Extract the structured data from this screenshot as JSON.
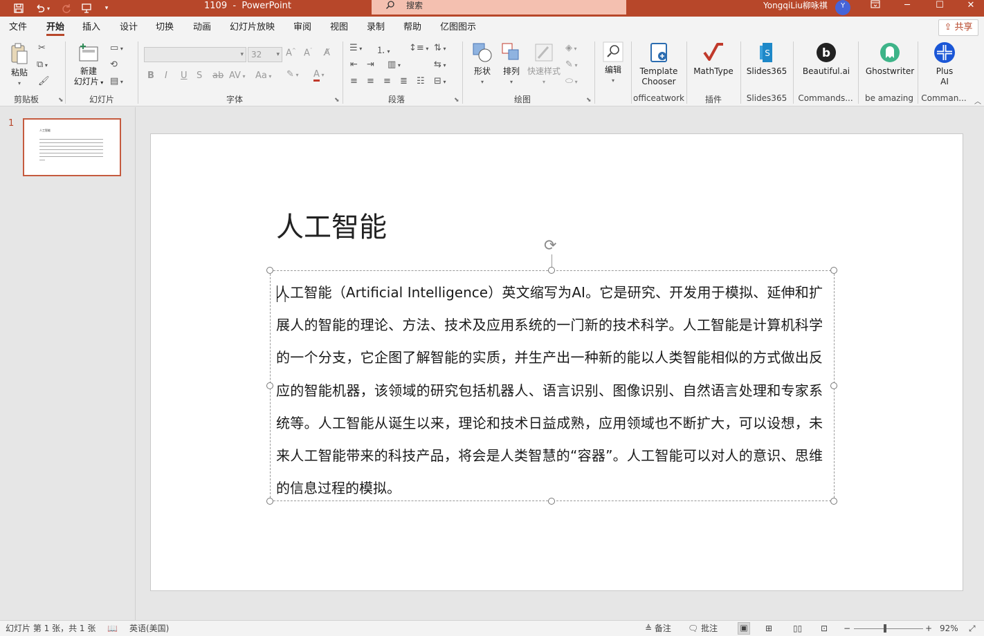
{
  "app": {
    "doc_title": "1109",
    "app_name": "PowerPoint",
    "search_placeholder": "搜索",
    "user_name": "YongqiLiu柳咏祺",
    "user_initial": "Y",
    "brand_color": "#b7472a"
  },
  "quick_access": {
    "save_icon": "save-icon",
    "undo_icon": "undo-icon",
    "redo_icon": "redo-icon",
    "present_icon": "presentation-icon",
    "customize_icon": "chevron-down-icon"
  },
  "menu": {
    "tabs": [
      "文件",
      "开始",
      "插入",
      "设计",
      "切换",
      "动画",
      "幻灯片放映",
      "审阅",
      "视图",
      "录制",
      "帮助",
      "亿图图示"
    ],
    "active_tab": "开始",
    "share_label": "共享"
  },
  "ribbon": {
    "clipboard": {
      "paste": "粘贴",
      "label": "剪贴板"
    },
    "slides": {
      "new_slide_line1": "新建",
      "new_slide_line2": "幻灯片",
      "label": "幻灯片"
    },
    "font": {
      "font_name": "",
      "font_size": "32",
      "label": "字体"
    },
    "paragraph": {
      "label": "段落"
    },
    "drawing": {
      "shapes": "形状",
      "arrange": "排列",
      "quick_styles": "快速样式",
      "label": "绘图"
    },
    "editing": {
      "edit": "编辑"
    },
    "addins": {
      "template_chooser_line1": "Template",
      "template_chooser_line2": "Chooser",
      "officeatwork": "officeatwork",
      "mathtype": "MathType",
      "plugins": "插件",
      "slides365": "Slides365",
      "slides365_group": "Slides365",
      "beautiful_ai": "Beautiful.ai",
      "commands": "Commands...",
      "ghostwriter": "Ghostwriter",
      "be_amazing": "be amazing",
      "plus_ai_line1": "Plus",
      "plus_ai_line2": "AI",
      "command_short": "Comman..."
    }
  },
  "slide_panel": {
    "slide_number": "1",
    "thumb_title": "人工智能"
  },
  "slide": {
    "title": "人工智能",
    "body": "人工智能（Artificial Intelligence）英文缩写为AI。它是研究、开发用于模拟、延伸和扩展人的智能的理论、方法、技术及应用系统的一门新的技术科学。人工智能是计算机科学的一个分支，它企图了解智能的实质，并生产出一种新的能以人类智能相似的方式做出反应的智能机器，该领域的研究包括机器人、语言识别、图像识别、自然语言处理和专家系统等。人工智能从诞生以来，理论和技术日益成熟，应用领域也不断扩大，可以设想，未来人工智能带来的科技产品，将会是人类智慧的“容器”。人工智能可以对人的意识、思维的信息过程的模拟。"
  },
  "status": {
    "slide_info": "幻灯片 第 1 张，共 1 张",
    "language": "英语(美国)",
    "notes": "备注",
    "comments": "批注",
    "zoom_minus": "−",
    "zoom_plus": "+",
    "zoom_level": "92%"
  }
}
